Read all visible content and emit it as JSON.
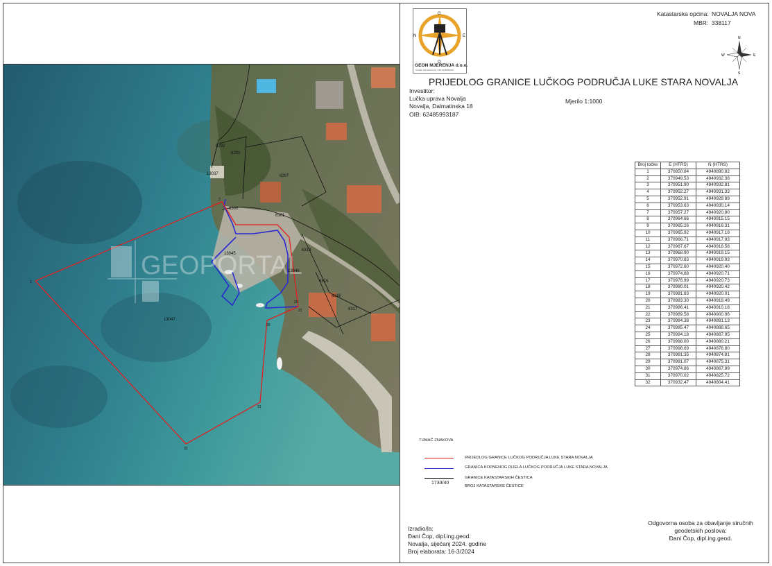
{
  "header": {
    "ko_label": "Katastarska općina:",
    "ko_value": "NOVALJA NOVA",
    "mbr_label": "MBR:",
    "mbr_value": "338117",
    "title": "PRIJEDLOG GRANICE LUČKOG PODRUČJA LUKE STARA NOVALJA",
    "scale": "Mjerilo 1:1000"
  },
  "logo": {
    "company": "GEON MJERENJA d.o.o.",
    "subtitle": "Novalja, Dalmatinska 18, OIB: 62485993187",
    "letters": [
      "G",
      "E",
      "O",
      "N"
    ]
  },
  "compass": {
    "n": "N",
    "s": "S",
    "e": "E",
    "w": "W"
  },
  "investor": {
    "label": "Investitor:",
    "name": "Lučka uprava Novalja",
    "address": "Novalja, Dalmatinska 18",
    "oib": "OIB: 62485993187"
  },
  "table": {
    "headers": [
      "Broj točke",
      "E (HTRS)",
      "N (HTRS)"
    ],
    "rows": [
      [
        "1",
        "370850.84",
        "4940890.82"
      ],
      [
        "2",
        "370949.53",
        "4940932.38"
      ],
      [
        "3",
        "370951.90",
        "4940932.81"
      ],
      [
        "4",
        "370952.27",
        "4940931.33"
      ],
      [
        "5",
        "370952.91",
        "4940929.89"
      ],
      [
        "6",
        "370953.63",
        "4940930.14"
      ],
      [
        "7",
        "370957.27",
        "4940920.80"
      ],
      [
        "8",
        "370964.66",
        "4940915.15"
      ],
      [
        "9",
        "370965.26",
        "4940916.31"
      ],
      [
        "10",
        "370965.92",
        "4940917.18"
      ],
      [
        "11",
        "370966.71",
        "4940917.93"
      ],
      [
        "12",
        "370967.67",
        "4940918.58"
      ],
      [
        "13",
        "370968.90",
        "4940919.15"
      ],
      [
        "14",
        "370970.83",
        "4940919.93"
      ],
      [
        "15",
        "370972.60",
        "4940920.40"
      ],
      [
        "16",
        "370974.88",
        "4940920.71"
      ],
      [
        "17",
        "370976.99",
        "4940920.73"
      ],
      [
        "18",
        "370980.01",
        "4940920.42"
      ],
      [
        "19",
        "370981.83",
        "4940920.01"
      ],
      [
        "20",
        "370983.30",
        "4940919.49"
      ],
      [
        "21",
        "370986.41",
        "4940910.18"
      ],
      [
        "22",
        "370989.58",
        "4940900.96"
      ],
      [
        "23",
        "370994.38",
        "4940891.13"
      ],
      [
        "24",
        "370995.47",
        "4940888.65"
      ],
      [
        "25",
        "370994.18",
        "4940887.95"
      ],
      [
        "26",
        "370998.00",
        "4940880.21"
      ],
      [
        "27",
        "370998.69",
        "4940878.80"
      ],
      [
        "28",
        "370991.35",
        "4940874.81"
      ],
      [
        "29",
        "370991.07",
        "4940875.31"
      ],
      [
        "30",
        "370974.86",
        "4940867.89"
      ],
      [
        "31",
        "370970.02",
        "4940825.72"
      ],
      [
        "32",
        "370932.47",
        "4940804.41"
      ]
    ]
  },
  "legend": {
    "title": "TUMAČ ZNAKOVA",
    "red": "PRIJEDLOG GRANICE LUČKOG PODRUČJA LUKE STARA NOVALJA",
    "blue": "GRANICA KOPNENOG DIJELA LUČKOG PODRUČJA LUKE STARA NOVALJA",
    "black": "GRANICE KATASTARSKIH ČESTICA",
    "parcel_example": "1733/40",
    "parcel_text": "BROJ KATASTARSKE ČESTICE",
    "colors": {
      "red": "#e02020",
      "blue": "#2a2ad0",
      "black": "#111111"
    }
  },
  "author": {
    "label": "Izradio/la:",
    "name": "Đani Čop, dipl.ing.geod.",
    "date": "Novalja, siječanj 2024. godine",
    "number": "Broj elaborata: 16-3/2024"
  },
  "responsible": {
    "line1": "Odgovorna osoba za obavljanje stručnih",
    "line2": "geodetskih poslova:",
    "name": "Đani Čop, dipl.ing.geod."
  },
  "map": {
    "watermark": "GEOPORTAL",
    "parcel_labels": [
      "13045",
      "13046",
      "13047",
      "13037",
      "6292",
      "6293",
      "6297",
      "6300",
      "6301",
      "6314",
      "6315",
      "6316",
      "6317"
    ],
    "point_labels": [
      "1",
      "2",
      "21",
      "25",
      "30",
      "31",
      "32"
    ]
  }
}
